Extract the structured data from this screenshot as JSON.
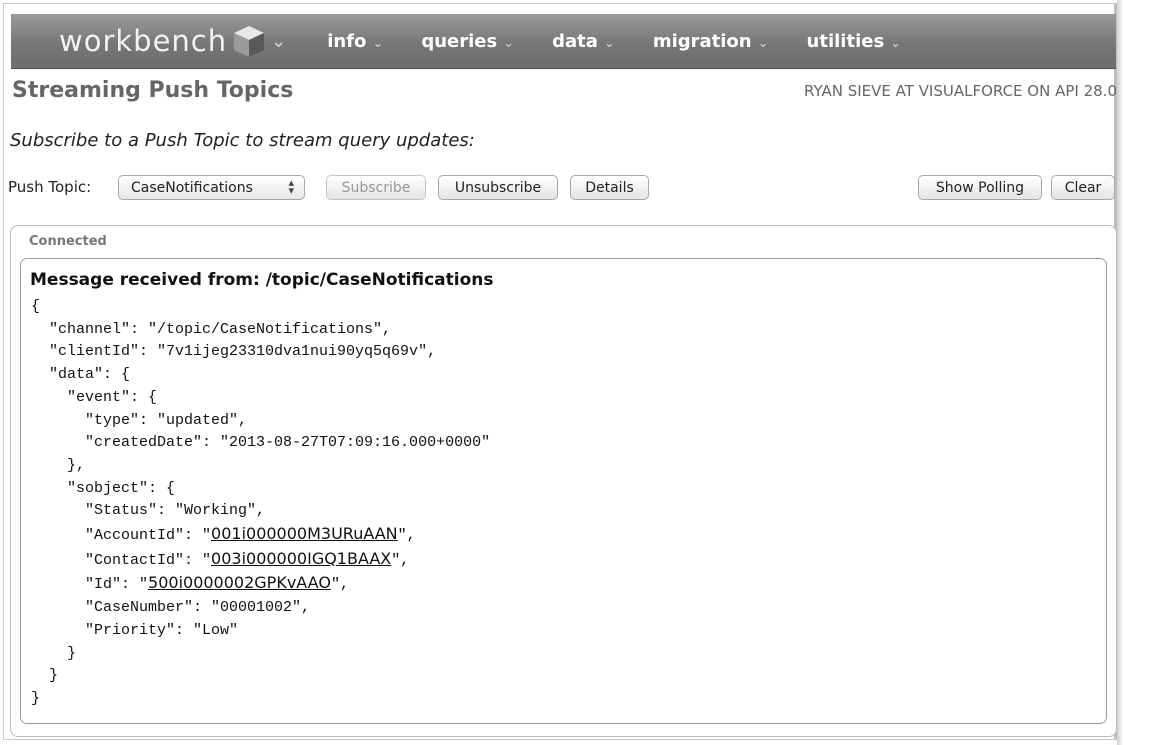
{
  "nav": {
    "logo_text": "workbench",
    "items": [
      {
        "label": "info"
      },
      {
        "label": "queries"
      },
      {
        "label": "data"
      },
      {
        "label": "migration"
      },
      {
        "label": "utilities"
      }
    ]
  },
  "header": {
    "title": "Streaming Push Topics",
    "user_info": "RYAN SIEVE AT VISUALFORCE ON API 28.0"
  },
  "subtitle": "Subscribe to a Push Topic to stream query updates:",
  "controls": {
    "push_topic_label": "Push Topic:",
    "selected_topic": "CaseNotifications",
    "subscribe_label": "Subscribe",
    "unsubscribe_label": "Unsubscribe",
    "details_label": "Details",
    "show_polling_label": "Show Polling",
    "clear_label": "Clear"
  },
  "panel": {
    "status": "Connected",
    "message_header": "Message received from: /topic/CaseNotifications",
    "lines": {
      "l1": "{",
      "l2": "  \"channel\": \"/topic/CaseNotifications\",",
      "l3": "  \"clientId\": \"7v1ijeg23310dva1nui90yq5q69v\",",
      "l4": "  \"data\": {",
      "l5": "    \"event\": {",
      "l6": "      \"type\": \"updated\",",
      "l7": "      \"createdDate\": \"2013-08-27T07:09:16.000+0000\"",
      "l8": "    },",
      "l9": "    \"sobject\": {",
      "l10": "      \"Status\": \"Working\",",
      "l15": "      \"CaseNumber\": \"00001002\",",
      "l16": "      \"Priority\": \"Low\"",
      "l17": "    }",
      "l18": "  }",
      "l19": "}"
    },
    "account_key": "      \"AccountId\": \"",
    "account_id": "001i000000M3URuAAN",
    "contact_key": "      \"ContactId\": \"",
    "contact_id": "003i000000IGQ1BAAX",
    "id_key": "      \"Id\": \"",
    "case_id": "500i0000002GPKvAAO",
    "link_suffix": "\","
  }
}
